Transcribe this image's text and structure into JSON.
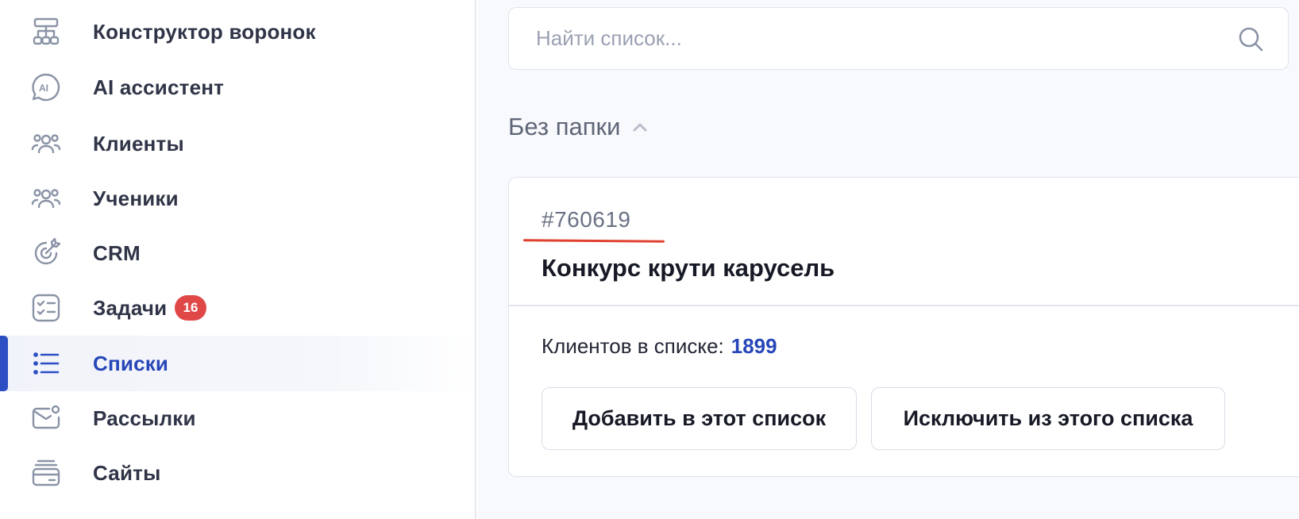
{
  "sidebar": {
    "items": [
      {
        "label": "Конструктор воронок",
        "icon": "funnel-builder-icon"
      },
      {
        "label": "AI ассистент",
        "icon": "ai-assistant-icon"
      },
      {
        "label": "Клиенты",
        "icon": "clients-icon"
      },
      {
        "label": "Ученики",
        "icon": "students-icon"
      },
      {
        "label": "CRM",
        "icon": "crm-target-icon"
      },
      {
        "label": "Задачи",
        "icon": "tasks-icon",
        "badge": "16"
      },
      {
        "label": "Списки",
        "icon": "lists-icon",
        "active": true
      },
      {
        "label": "Рассылки",
        "icon": "mail-icon"
      },
      {
        "label": "Сайты",
        "icon": "sites-icon"
      }
    ]
  },
  "main": {
    "search": {
      "placeholder": "Найти список...",
      "value": "",
      "icon": "search-icon"
    },
    "folder": {
      "title": "Без папки",
      "icon": "chevron-up-icon"
    },
    "card": {
      "id": "#760619",
      "name": "Конкурс крути карусель",
      "count_label": "Клиентов в списке:",
      "count_value": "1899",
      "add_button": "Добавить в этот список",
      "exclude_button": "Исключить из этого списка"
    }
  },
  "colors": {
    "accent": "#2747b8",
    "badge": "#e04848",
    "underline": "#e0412e",
    "icon": "#8a93a6"
  }
}
